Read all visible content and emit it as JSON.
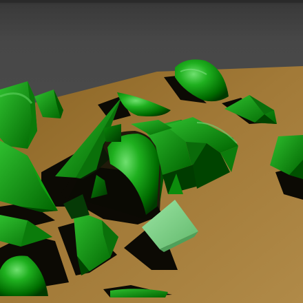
{
  "viewport": {
    "title": "",
    "colors": {
      "background": "#4a4a4a",
      "floor": "#a57d3a",
      "floor_shadow": "#0a0a05",
      "object_green": "#00a000",
      "object_dark_green": "#005a00",
      "highlight_green": "#7dd07d",
      "selected_object": "#80d090"
    }
  },
  "scene": {
    "floor_label": "ground-plane",
    "object_count": 18,
    "selected_object": "pale-green-cube"
  }
}
